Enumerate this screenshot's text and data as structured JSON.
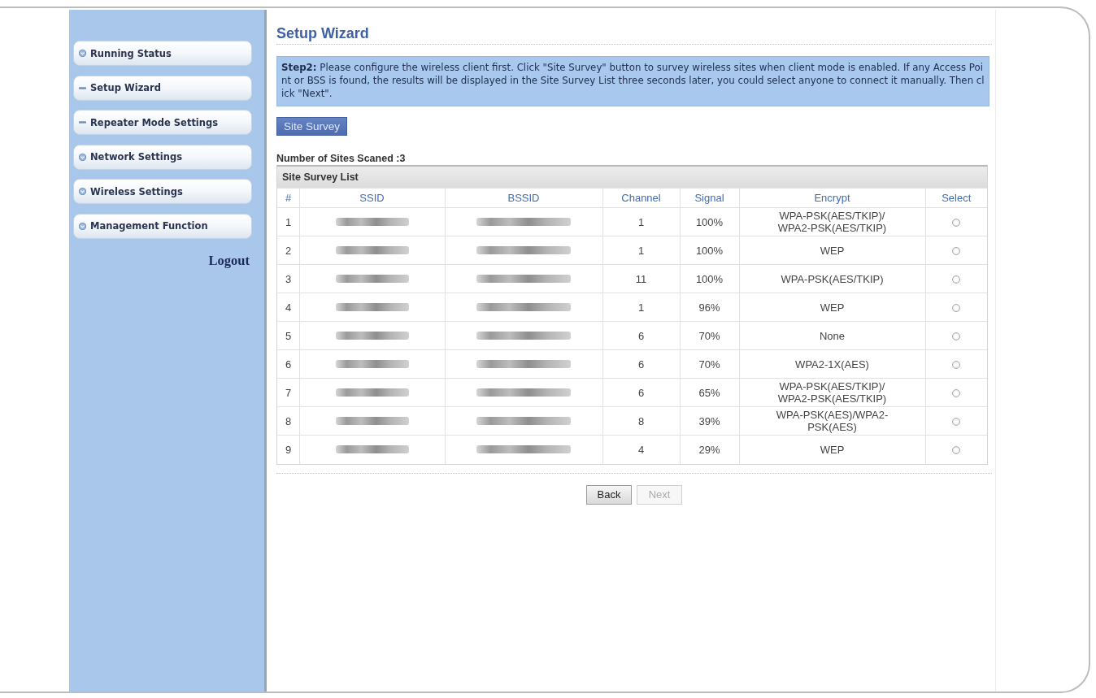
{
  "sidebar": {
    "items": [
      {
        "label": "Running Status",
        "expanded": false
      },
      {
        "label": "Setup Wizard",
        "expanded": true
      },
      {
        "label": "Repeater Mode Settings",
        "expanded": true
      },
      {
        "label": "Network Settings",
        "expanded": false
      },
      {
        "label": "Wireless Settings",
        "expanded": false
      },
      {
        "label": "Management Function",
        "expanded": false
      }
    ],
    "logout": "Logout"
  },
  "page": {
    "title": "Setup Wizard",
    "instructions": "**Step2:** Please configure the wireless client first. Click \"Site Survey\" button to survey wireless sites when client mode is enabled. If any Access Point or BSS is found, the results will be displayed in the Site Survey List three seconds later, you could select anyone to connect it manually. Then click \"Next\".",
    "site_survey_button": "Site Survey",
    "sites_scanned": "Number of Sites Scaned :3"
  },
  "table": {
    "title": "Site Survey List",
    "columns": [
      "#",
      "SSID",
      "BSSID",
      "Channel",
      "Signal",
      "Encrypt",
      "Select"
    ],
    "rows": [
      {
        "number": "1",
        "channel": "1",
        "signal": "100%",
        "encrypt": "WPA-PSK(AES/TKIP)/WPA2-PSK(AES/TKIP)",
        "selected": false
      },
      {
        "number": "2",
        "channel": "1",
        "signal": "100%",
        "encrypt": "WEP",
        "selected": false
      },
      {
        "number": "3",
        "channel": "11",
        "signal": "100%",
        "encrypt": "WPA-PSK(AES/TKIP)",
        "selected": false
      },
      {
        "number": "4",
        "channel": "1",
        "signal": "96%",
        "encrypt": "WEP",
        "selected": false
      },
      {
        "number": "5",
        "channel": "6",
        "signal": "70%",
        "encrypt": "None",
        "selected": false
      },
      {
        "number": "6",
        "channel": "6",
        "signal": "70%",
        "encrypt": "WPA2-1X(AES)",
        "selected": false
      },
      {
        "number": "7",
        "channel": "6",
        "signal": "65%",
        "encrypt": "WPA-PSK(AES/TKIP)/WPA2-PSK(AES/TKIP)",
        "selected": false
      },
      {
        "number": "8",
        "channel": "8",
        "signal": "39%",
        "encrypt": "WPA-PSK(AES)/WPA2-PSK(AES)",
        "selected": false
      },
      {
        "number": "9",
        "channel": "4",
        "signal": "29%",
        "encrypt": "WEP",
        "selected": false
      }
    ]
  },
  "buttons": [
    {
      "label": "Back",
      "disabled": false
    },
    {
      "label": "Next",
      "disabled": true
    }
  ]
}
